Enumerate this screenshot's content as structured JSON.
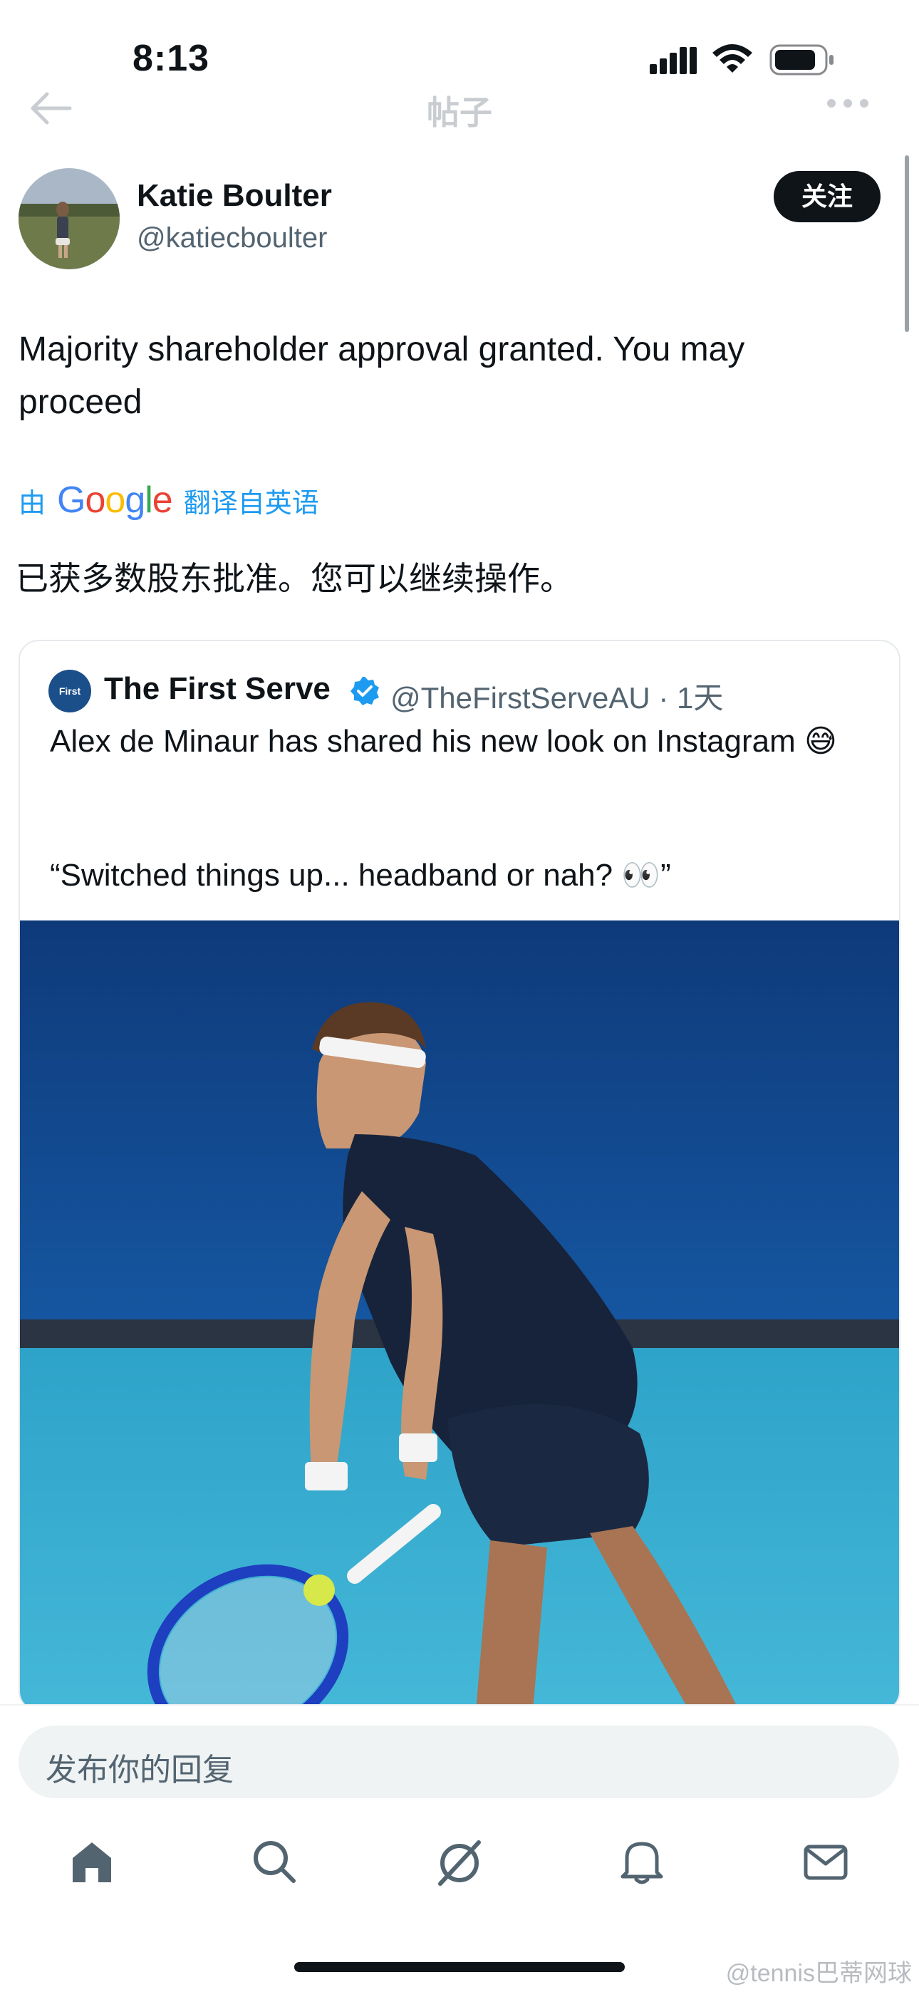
{
  "status_bar": {
    "time": "8:13"
  },
  "nav": {
    "title": "帖子"
  },
  "post": {
    "display_name": "Katie Boulter",
    "handle": "@katiecboulter",
    "follow_label": "关注",
    "text": "Majority shareholder approval granted. You may proceed",
    "translation": {
      "by": "由",
      "google": "Google",
      "from": "翻译自英语"
    },
    "translated_text": "已获多数股东批准。您可以继续操作。"
  },
  "quote": {
    "avatar_text": "First Serve",
    "display_name": "The First Serve",
    "handle_time": "@TheFirstServeAU · 1天",
    "text_line1": "Alex de Minaur has shared his new look on Instagram 😅",
    "text_line2": "“Switched things up... headband or nah? 👀”"
  },
  "reply": {
    "placeholder": "发布你的回复"
  },
  "watermark": "@tennis巴蒂网球"
}
